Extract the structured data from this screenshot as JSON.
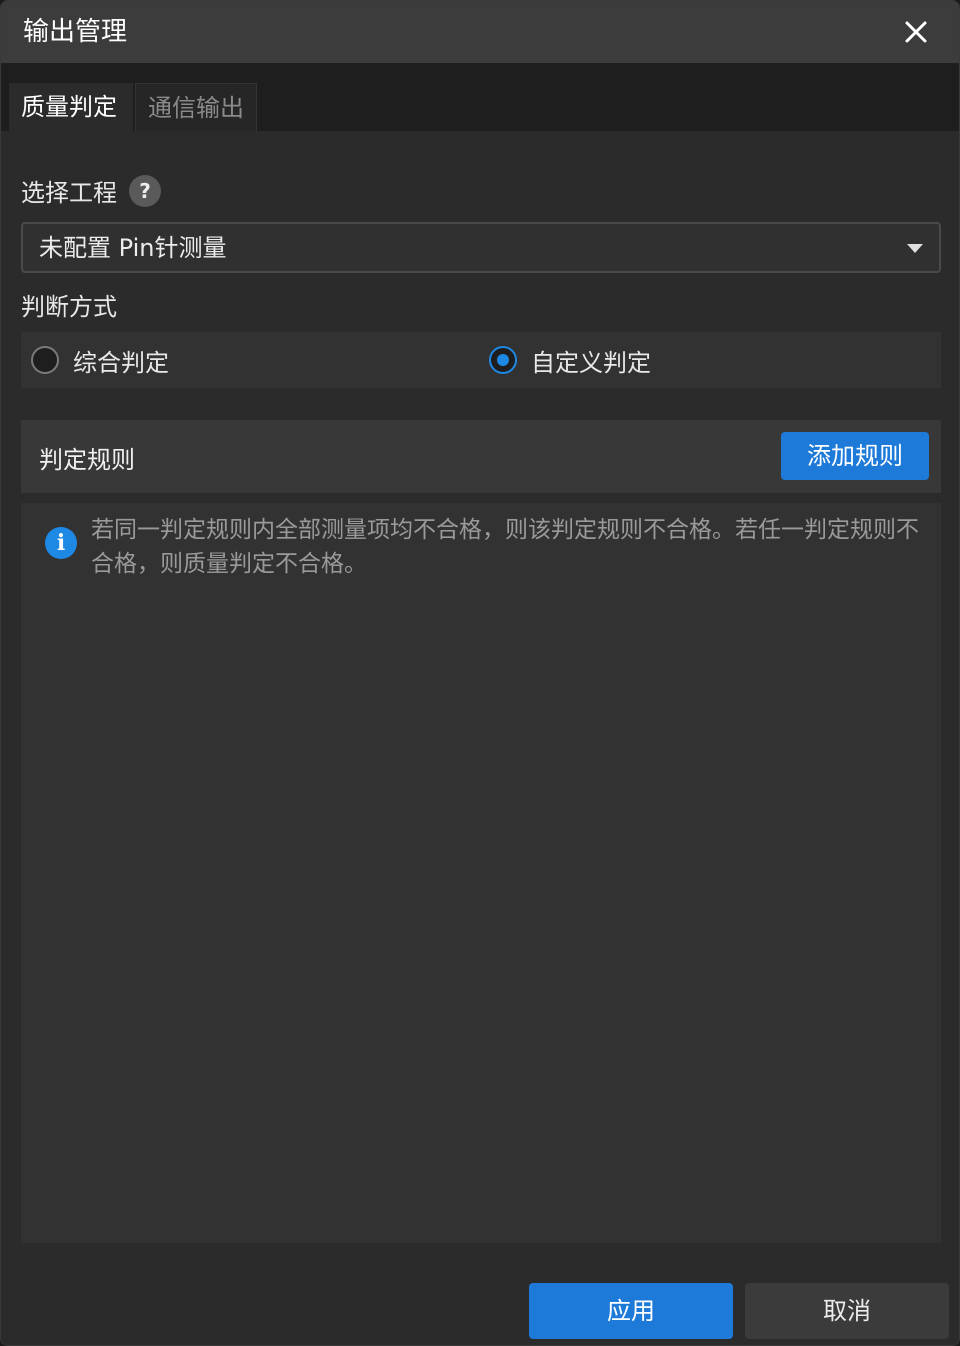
{
  "window": {
    "title": "输出管理",
    "close_icon": "close-icon"
  },
  "tabs": [
    {
      "label": "质量判定",
      "active": true
    },
    {
      "label": "通信输出",
      "active": false
    }
  ],
  "project": {
    "label": "选择工程",
    "help_glyph": "?",
    "selected": "未配置 Pin针测量"
  },
  "judgement": {
    "label": "判断方式",
    "options": [
      {
        "label": "综合判定",
        "checked": false
      },
      {
        "label": "自定义判定",
        "checked": true
      }
    ]
  },
  "rules": {
    "title": "判定规则",
    "add_button": "添加规则",
    "info_glyph": "i",
    "info_text": "若同一判定规则内全部测量项均不合格，则该判定规则不合格。若任一判定规则不合格，则质量判定不合格。"
  },
  "footer": {
    "apply": "应用",
    "cancel": "取消"
  },
  "colors": {
    "accent": "#1e7ad8",
    "background": "#2b2b2b",
    "titlebar": "#3c3c3c"
  }
}
